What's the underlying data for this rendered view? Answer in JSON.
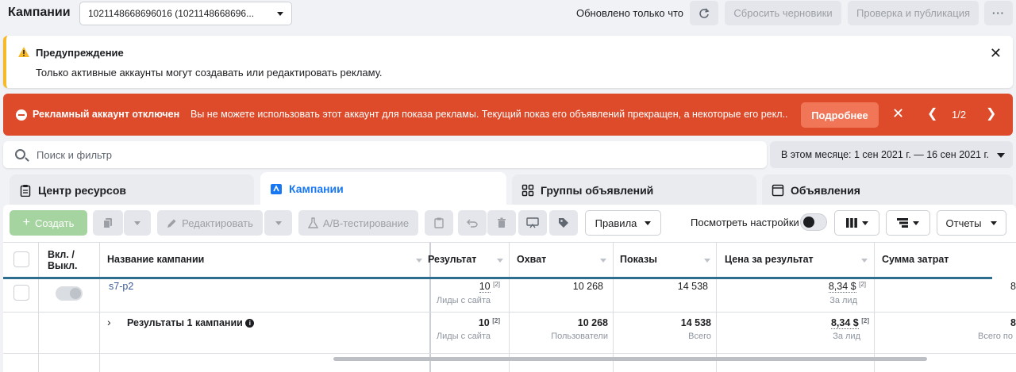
{
  "topbar": {
    "title": "Кампании",
    "account": "1021148668696016 (1021148668696...",
    "updated": "Обновлено только что",
    "reset_label": "Сбросить черновики",
    "publish_label": "Проверка и публикация",
    "more_label": "···"
  },
  "warning": {
    "title": "Предупреждение",
    "text": "Только активные аккаунты могут создавать или редактировать рекламу."
  },
  "error_banner": {
    "title": "Рекламный аккаунт отключен",
    "text": "Вы не можете использовать этот аккаунт для показа рекламы. Текущий показ его объявлений прекращен, а некоторые его рекл...",
    "button": "Подробнее",
    "pager": "1/2"
  },
  "search": {
    "placeholder": "Поиск и фильтр"
  },
  "date_range": "В этом месяце: 1 сен 2021 г. — 16 сен 2021 г.",
  "tabs": [
    {
      "label": "Центр ресурсов"
    },
    {
      "label": "Кампании"
    },
    {
      "label": "Группы объявлений"
    },
    {
      "label": "Объявления"
    }
  ],
  "toolbar": {
    "create": "Создать",
    "edit": "Редактировать",
    "ab_test": "A/B-тестирование",
    "rules": "Правила",
    "view_settings": "Посмотреть настройки",
    "reports": "Отчеты"
  },
  "table": {
    "headers": {
      "toggle": "Вкл. / Выкл.",
      "name": "Название кампании",
      "result": "Результат",
      "reach": "Охват",
      "impressions": "Показы",
      "cpr": "Цена за результат",
      "spend": "Сумма затрат"
    },
    "row": {
      "name": "s7-p2",
      "result": "10",
      "result_sub": "Лиды с сайта",
      "reach": "10 268",
      "impressions": "14 538",
      "cpr": "8,34 $",
      "cpr_sub": "За лид",
      "spend": "8"
    },
    "total": {
      "label": "Результаты 1 кампании",
      "result": "10",
      "result_sub": "Лиды с сайта",
      "reach": "10 268",
      "reach_sub": "Пользователи",
      "impressions": "14 538",
      "impressions_sub": "Всего",
      "cpr": "8,34 $",
      "cpr_sub": "За лид",
      "spend": "8",
      "spend_sub": "Всего по"
    },
    "note": "[2]"
  },
  "colors": {
    "error": "#de4b2a",
    "warning": "#f7b928",
    "link": "#385898",
    "active_tab": "#1877f2",
    "create": "#a5d4a0"
  }
}
